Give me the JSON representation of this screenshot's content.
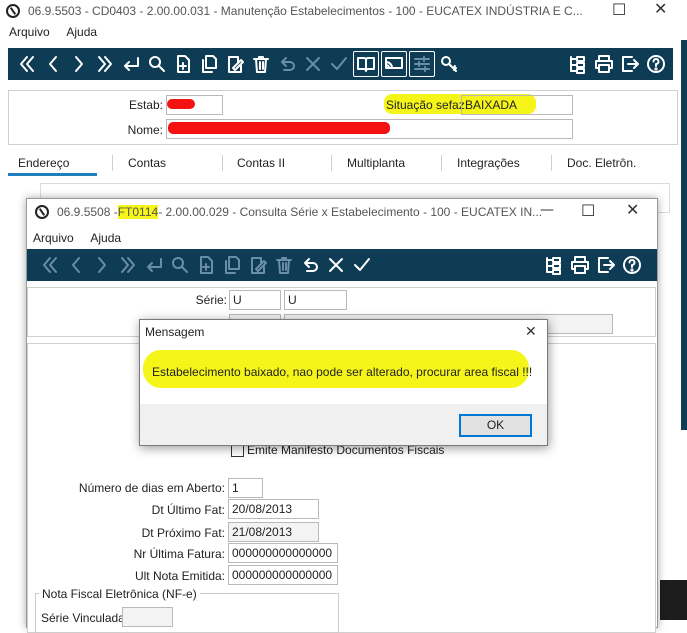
{
  "main": {
    "title": "06.9.5503 - CD0403 - 2.00.00.031 - Manutenção Estabelecimentos - 100 - EUCATEX INDÚSTRIA E C...",
    "menu": [
      "Arquivo",
      "Ajuda"
    ],
    "estab_label": "Estab:",
    "situacao_label": "Situação sefaz:",
    "situacao_value": "BAIXADA",
    "nome_label": "Nome:",
    "tabs": [
      "Endereço",
      "Contas",
      "Contas II",
      "Multiplanta",
      "Integrações",
      "Doc. Eletrôn."
    ]
  },
  "sub": {
    "title_prefix": "06.9.5508 - ",
    "title_code": "FT0114",
    "title_suffix": " - 2.00.00.029 - Consulta Série x Estabelecimento - 100 - EUCATEX IN...",
    "menu": [
      "Arquivo",
      "Ajuda"
    ],
    "serie_label": "Série:",
    "serie_value1": "U",
    "serie_value2": "U",
    "emite_label": "Emite Manifesto Documentos Fiscais",
    "dias_label": "Número de dias em Aberto:",
    "dias_value": "1",
    "ultimo_fat_label": "Dt Último Fat:",
    "ultimo_fat_value": "20/08/2013",
    "proximo_fat_label": "Dt Próximo Fat:",
    "proximo_fat_value": "21/08/2013",
    "ultima_fatura_label": "Nr Última Fatura:",
    "ultima_fatura_value": "000000000000000",
    "ult_nota_label": "Ult Nota Emitida:",
    "ult_nota_value": "000000000000000",
    "nfe_group_label": "Nota Fiscal Eletrônica (NF-e)",
    "serie_vinculada_label": "Série Vinculada:"
  },
  "dialog": {
    "title": "Mensagem",
    "message": "Estabelecimento baixado, nao pode ser alterado, procurar area fiscal !!!",
    "ok_label": "OK"
  },
  "colors": {
    "toolbar": "#0e3c55",
    "highlight": "#f5f51a",
    "redaction": "#f21212",
    "tab_active": "#1f7fbf"
  }
}
